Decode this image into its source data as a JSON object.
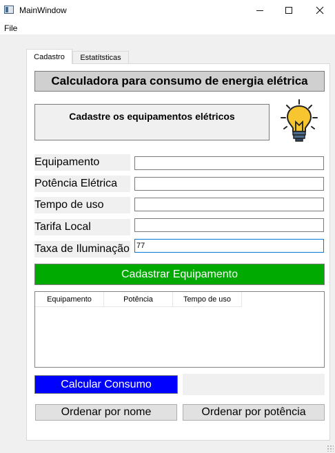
{
  "window": {
    "title": "MainWindow"
  },
  "menu": {
    "file": "File"
  },
  "tabs": [
    {
      "label": "Cadastro",
      "active": true
    },
    {
      "label": "Estatítsticas",
      "active": false
    }
  ],
  "header": {
    "title": "Calculadora para consumo de energia elétrica",
    "subtitle": "Cadastre os equipamentos elétricos"
  },
  "form": {
    "fields": [
      {
        "label": "Equipamento",
        "value": ""
      },
      {
        "label": "Potência Elétrica",
        "value": ""
      },
      {
        "label": "Tempo de uso",
        "value": ""
      },
      {
        "label": "Tarifa Local",
        "value": ""
      },
      {
        "label": "Taxa de Iluminação",
        "value": "77"
      }
    ],
    "submit_label": "Cadastrar Equipamento"
  },
  "table": {
    "columns": [
      "Equipamento",
      "Potência",
      "Tempo de uso"
    ],
    "rows": []
  },
  "actions": {
    "calcular_label": "Calcular Consumo",
    "ordenar_nome_label": "Ordenar por nome",
    "ordenar_potencia_label": "Ordenar por potência"
  },
  "colors": {
    "cadastrar_button": "#00aa00",
    "calcular_button": "#0000ff"
  },
  "icons": {
    "app": "app-window-icon",
    "bulb": "lightbulb-icon"
  }
}
